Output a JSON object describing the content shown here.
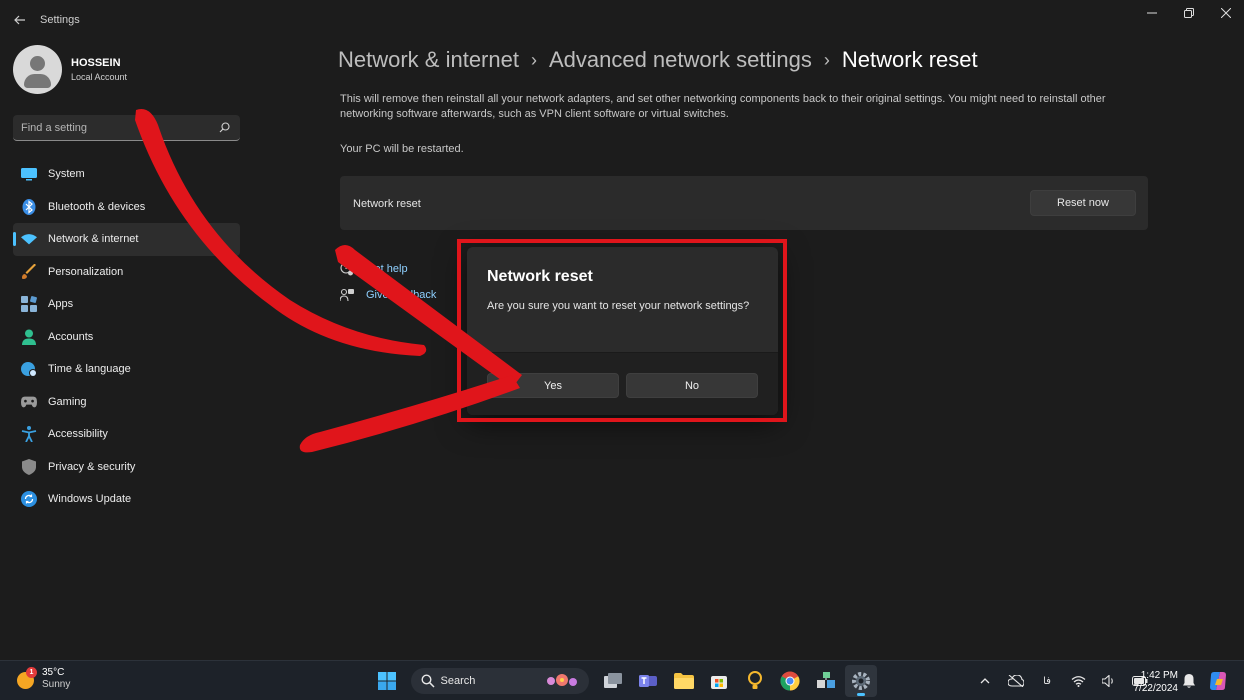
{
  "window": {
    "title": "Settings"
  },
  "profile": {
    "name": "HOSSEIN",
    "account_type": "Local Account"
  },
  "search": {
    "placeholder": "Find a setting"
  },
  "nav": {
    "items": [
      {
        "label": "System",
        "icon": "monitor-icon",
        "color": "#4cc2ff"
      },
      {
        "label": "Bluetooth & devices",
        "icon": "bluetooth-icon",
        "color": "#3a8ee6"
      },
      {
        "label": "Network & internet",
        "icon": "wifi-icon",
        "color": "#4cc2ff",
        "selected": true
      },
      {
        "label": "Personalization",
        "icon": "brush-icon",
        "color": "#e8a33b"
      },
      {
        "label": "Apps",
        "icon": "apps-icon",
        "color": "#8ab4d8"
      },
      {
        "label": "Accounts",
        "icon": "person-icon",
        "color": "#2fbf8f"
      },
      {
        "label": "Time & language",
        "icon": "globe-clock-icon",
        "color": "#3aa0e0"
      },
      {
        "label": "Gaming",
        "icon": "gamepad-icon",
        "color": "#9a9a9a"
      },
      {
        "label": "Accessibility",
        "icon": "accessibility-icon",
        "color": "#3aa0e0"
      },
      {
        "label": "Privacy & security",
        "icon": "shield-icon",
        "color": "#8a8a8a"
      },
      {
        "label": "Windows Update",
        "icon": "update-icon",
        "color": "#2b8fe0"
      }
    ]
  },
  "breadcrumb": {
    "level1": "Network & internet",
    "level2": "Advanced network settings",
    "current": "Network reset",
    "separator": "›"
  },
  "main": {
    "description": "This will remove then reinstall all your network adapters, and set other networking components back to their original settings. You might need to reinstall other networking software afterwards, such as VPN client software or virtual switches.",
    "restart_note": "Your PC will be restarted.",
    "card_label": "Network reset",
    "reset_button": "Reset now",
    "get_help": "Get help",
    "give_feedback": "Give feedback"
  },
  "dialog": {
    "title": "Network reset",
    "message": "Are you sure you want to reset your network settings?",
    "yes": "Yes",
    "no": "No"
  },
  "taskbar": {
    "weather_temp": "35°C",
    "weather_desc": "Sunny",
    "weather_badge": "1",
    "search_label": "Search",
    "time": "1:42 PM",
    "date": "7/22/2024",
    "language": "فا"
  },
  "colors": {
    "accent": "#4cc2ff",
    "annotation_red": "#e0151b"
  }
}
